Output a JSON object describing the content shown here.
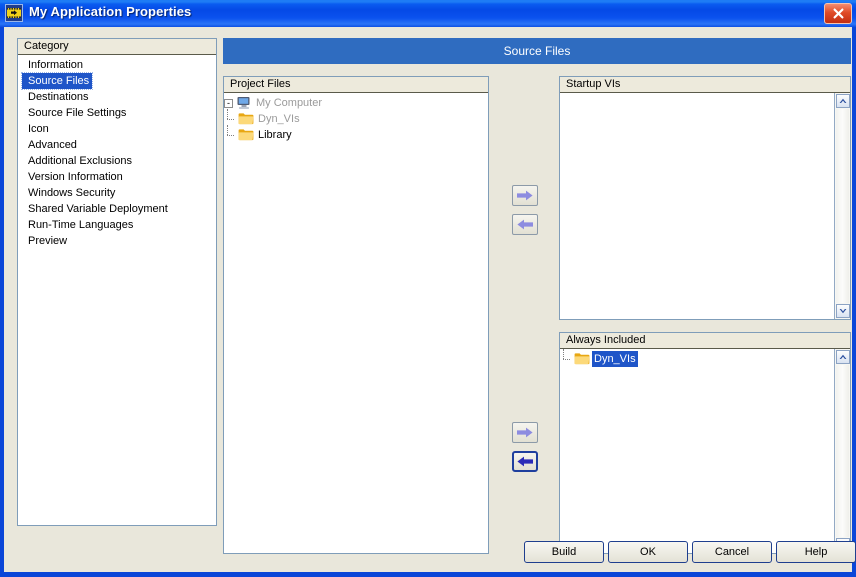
{
  "window": {
    "title": "My Application Properties",
    "icon": "labview-vi-icon",
    "close_label": "close-icon",
    "frame_color": "#0A46D8",
    "titlebar_color": "#0A5CF0",
    "client_bg": "#E9E7DB"
  },
  "banner": {
    "title": "Source Files",
    "bg": "#2F6CC0",
    "fg": "#FFFFFF"
  },
  "category": {
    "header": "Category",
    "selected": "Source Files",
    "items": [
      {
        "label": "Information",
        "selected": false
      },
      {
        "label": "Source Files",
        "selected": true
      },
      {
        "label": "Destinations",
        "selected": false
      },
      {
        "label": "Source File Settings",
        "selected": false
      },
      {
        "label": "Icon",
        "selected": false
      },
      {
        "label": "Advanced",
        "selected": false
      },
      {
        "label": "Additional Exclusions",
        "selected": false
      },
      {
        "label": "Version Information",
        "selected": false
      },
      {
        "label": "Windows Security",
        "selected": false
      },
      {
        "label": "Shared Variable Deployment",
        "selected": false
      },
      {
        "label": "Run-Time Languages",
        "selected": false
      },
      {
        "label": "Preview",
        "selected": false
      }
    ]
  },
  "project_files": {
    "header": "Project Files",
    "rows": [
      {
        "label": "My Computer",
        "icon": "computer-icon",
        "depth": 0,
        "dim": true,
        "selected": false,
        "expander": "-"
      },
      {
        "label": "Dyn_VIs",
        "icon": "folder-icon",
        "depth": 1,
        "dim": true,
        "selected": false,
        "expander": ""
      },
      {
        "label": "Library",
        "icon": "folder-icon",
        "depth": 1,
        "dim": false,
        "selected": false,
        "expander": ""
      }
    ]
  },
  "startup_vis": {
    "header": "Startup VIs",
    "rows": [],
    "scrollbar": {
      "up": "chevron-up-icon",
      "down": "chevron-down-icon"
    }
  },
  "always_included": {
    "header": "Always Included",
    "rows": [
      {
        "label": "Dyn_VIs",
        "icon": "folder-icon",
        "depth": 1,
        "dim": false,
        "selected": true,
        "expander": ""
      }
    ],
    "scrollbar": {
      "up": "chevron-up-icon",
      "down": "chevron-down-icon"
    }
  },
  "transfer_buttons": {
    "add_startup": {
      "name": "arrow-right-icon",
      "active": false
    },
    "remove_startup": {
      "name": "arrow-left-icon",
      "active": false
    },
    "add_always": {
      "name": "arrow-right-icon",
      "active": false
    },
    "remove_always": {
      "name": "arrow-left-icon",
      "active": true
    }
  },
  "dialog_buttons": {
    "build": "Build",
    "ok": "OK",
    "cancel": "Cancel",
    "help": "Help"
  }
}
